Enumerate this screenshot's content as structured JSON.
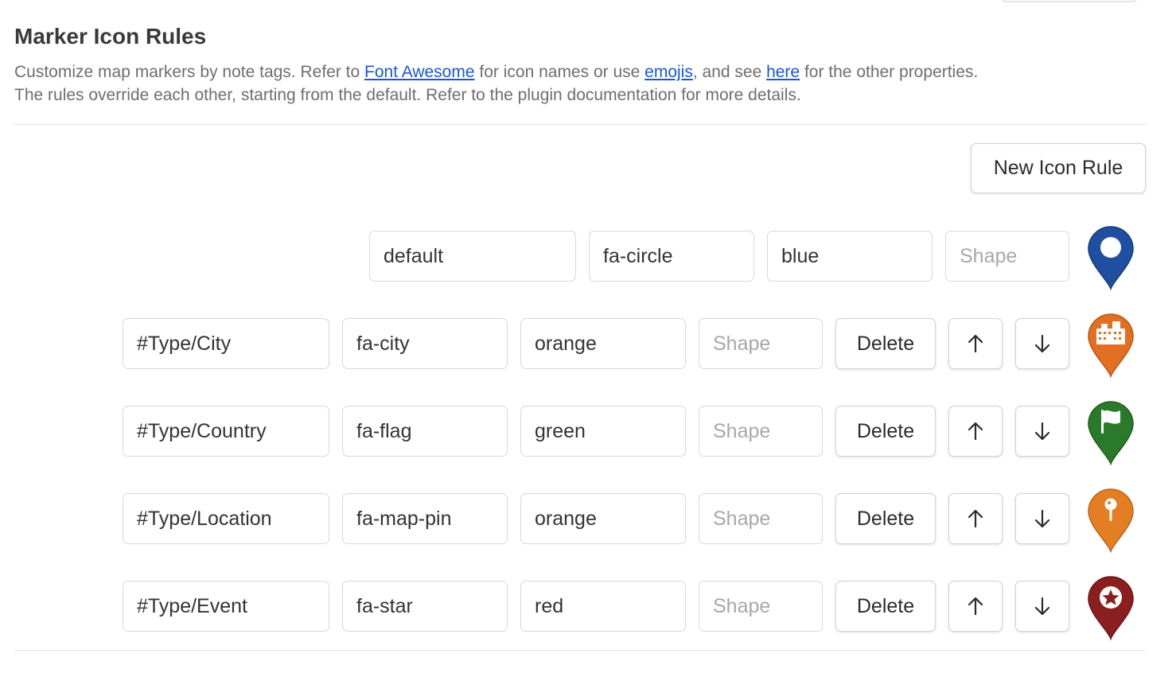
{
  "header": {
    "title": "Marker Icon Rules",
    "description": {
      "line1_pre": "Customize map markers by note tags. Refer to ",
      "link_font_awesome": "Font Awesome",
      "line1_mid": " for icon names or use ",
      "link_emojis": "emojis",
      "line1_mid2": ", and see ",
      "link_here": "here",
      "line1_post": " for the other properties.",
      "line2": "The rules override each other, starting from the default. Refer to the plugin documentation for more details."
    }
  },
  "new_rule_button": "New Icon Rule",
  "shape_placeholder": "Shape",
  "delete_label": "Delete",
  "default_rule": {
    "tag": "default",
    "icon": "fa-circle",
    "color": "blue",
    "shape": "",
    "marker_icon": "circle-icon",
    "marker_color": "#1f4fa0"
  },
  "rules": [
    {
      "tag": "#Type/City",
      "icon": "fa-city",
      "color": "orange",
      "shape": "",
      "marker_icon": "city-icon",
      "marker_color": "#e36f22"
    },
    {
      "tag": "#Type/Country",
      "icon": "fa-flag",
      "color": "green",
      "shape": "",
      "marker_icon": "flag-icon",
      "marker_color": "#2b7a2b"
    },
    {
      "tag": "#Type/Location",
      "icon": "fa-map-pin",
      "color": "orange",
      "shape": "",
      "marker_icon": "map-pin-icon",
      "marker_color": "#e37f22"
    },
    {
      "tag": "#Type/Event",
      "icon": "fa-star",
      "color": "red",
      "shape": "",
      "marker_icon": "star-icon",
      "marker_color": "#8b1f1f"
    }
  ]
}
